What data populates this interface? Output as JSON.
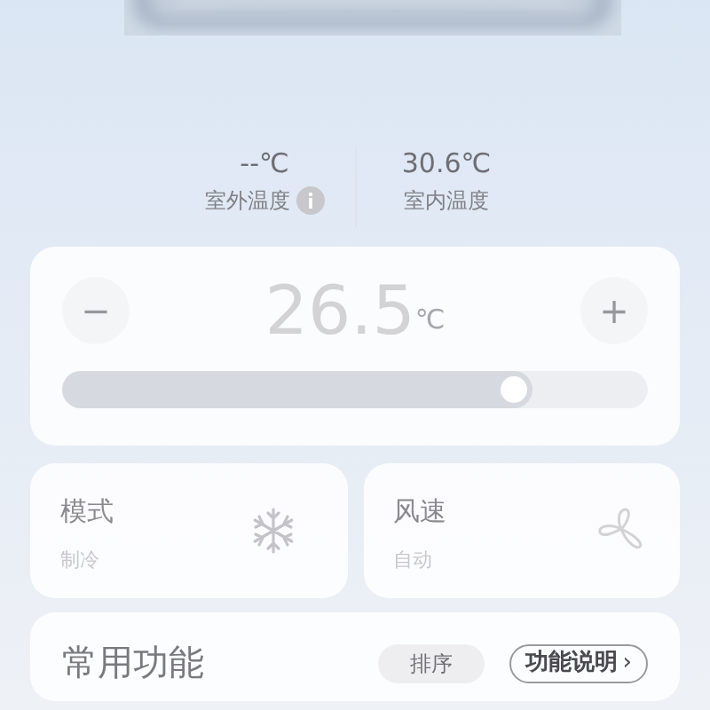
{
  "readings": [
    {
      "value": "--℃",
      "label": "室外温度",
      "info": true
    },
    {
      "value": "30.6℃",
      "label": "室内温度",
      "info": false
    }
  ],
  "temperature": {
    "decrease": "−",
    "value": "26.5",
    "unit": "℃",
    "increase": "+",
    "level": 0.77
  },
  "tiles": [
    {
      "title": "模式",
      "value": "制冷",
      "kind": "snowflake"
    },
    {
      "title": "风速",
      "value": "自动",
      "kind": "fan"
    }
  ],
  "functions": {
    "title": "常用功能",
    "sort": "排序",
    "help": "功能说明",
    "help_caret": "›"
  }
}
